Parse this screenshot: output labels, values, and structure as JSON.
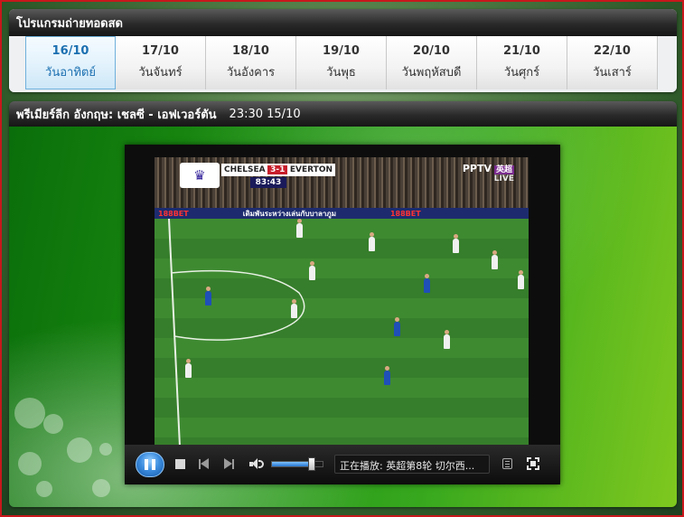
{
  "schedule": {
    "title": "โปรแกรมถ่ายทอดสด",
    "days": [
      {
        "date": "16/10",
        "name": "วันอาทิตย์",
        "active": true
      },
      {
        "date": "17/10",
        "name": "วันจันทร์",
        "active": false
      },
      {
        "date": "18/10",
        "name": "วันอังคาร",
        "active": false
      },
      {
        "date": "19/10",
        "name": "วันพุธ",
        "active": false
      },
      {
        "date": "20/10",
        "name": "วันพฤหัสบดี",
        "active": false
      },
      {
        "date": "21/10",
        "name": "วันศุกร์",
        "active": false
      },
      {
        "date": "22/10",
        "name": "วันเสาร์",
        "active": false
      }
    ]
  },
  "player_panel": {
    "title": "พรีเมียร์ลีก อังกฤษ: เชลซี - เอฟเวอร์ตัน",
    "match_time": "23:30 15/10"
  },
  "video": {
    "scorebug": {
      "home": "CHELSEA",
      "score": "3-1",
      "away": "EVERTON",
      "clock": "83:43"
    },
    "broadcaster": {
      "name": "PPTV",
      "tag": "英超",
      "live": "LIVE"
    },
    "adboard": [
      "188BET",
      "เดิมพันระหว่างเล่นกับบาลาภูม",
      "188BET"
    ]
  },
  "controls": {
    "play_state": "pause-icon",
    "volume_level": 0.78,
    "status_text": "正在播放: 英超第8轮 切尔西...",
    "icons": [
      "pause-icon",
      "stop-icon",
      "previous-icon",
      "next-icon",
      "volume-icon",
      "menu-icon",
      "fullscreen-icon"
    ]
  },
  "colors": {
    "frame_border": "#c8181c",
    "active_tab_text": "#1b6fb0",
    "panel_header": "#2a2a2a",
    "play_button": "#3d8ee0"
  }
}
